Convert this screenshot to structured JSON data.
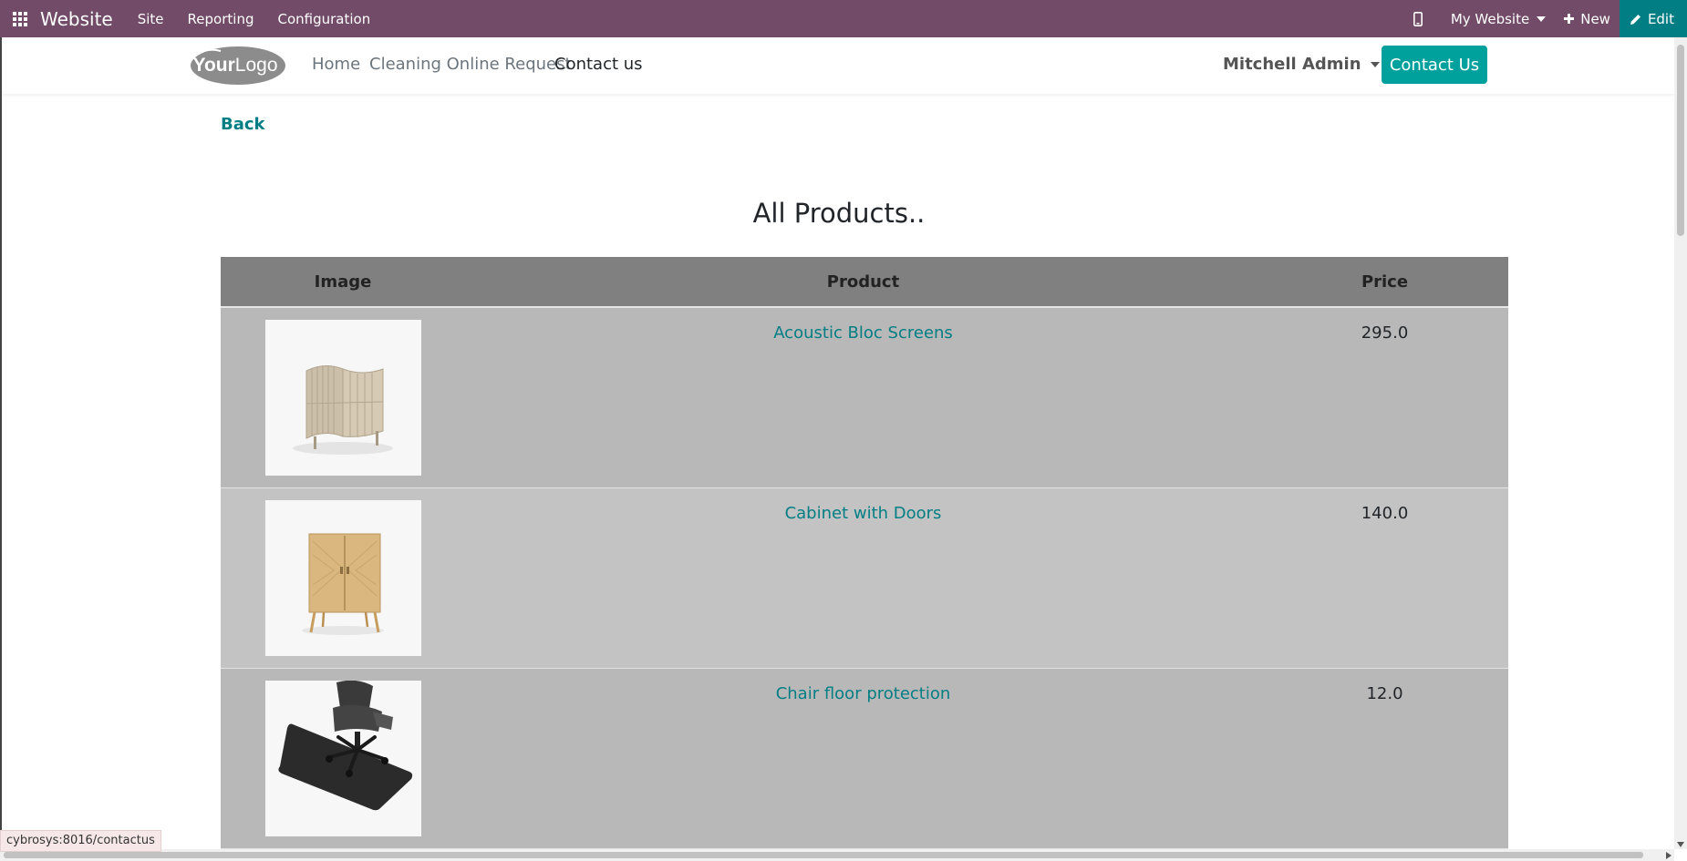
{
  "topbar": {
    "app_name": "Website",
    "menus": [
      "Site",
      "Reporting",
      "Configuration"
    ],
    "website_selector": "My Website",
    "new_label": "New",
    "edit_label": "Edit",
    "bg_color": "#714b67",
    "edit_bg_color": "#017e84"
  },
  "header": {
    "logo_text": "YourLogo",
    "nav": [
      "Home",
      "Cleaning Online Request",
      "Contact us"
    ],
    "active_nav": "Contact us",
    "user_name": "Mitchell Admin",
    "contact_button": "Contact Us",
    "accent_color": "#00a09d"
  },
  "page": {
    "back_label": "Back",
    "title": "All Products.."
  },
  "table": {
    "columns": [
      "Image",
      "Product",
      "Price"
    ],
    "rows": [
      {
        "product": "Acoustic Bloc Screens",
        "price": "295.0",
        "image_icon": "acoustic-screen-image"
      },
      {
        "product": "Cabinet with Doors",
        "price": "140.0",
        "image_icon": "cabinet-image"
      },
      {
        "product": "Chair floor protection",
        "price": "12.0",
        "image_icon": "chair-mat-image"
      }
    ]
  },
  "status_bar": {
    "url": "cybrosys:8016/contactus"
  }
}
